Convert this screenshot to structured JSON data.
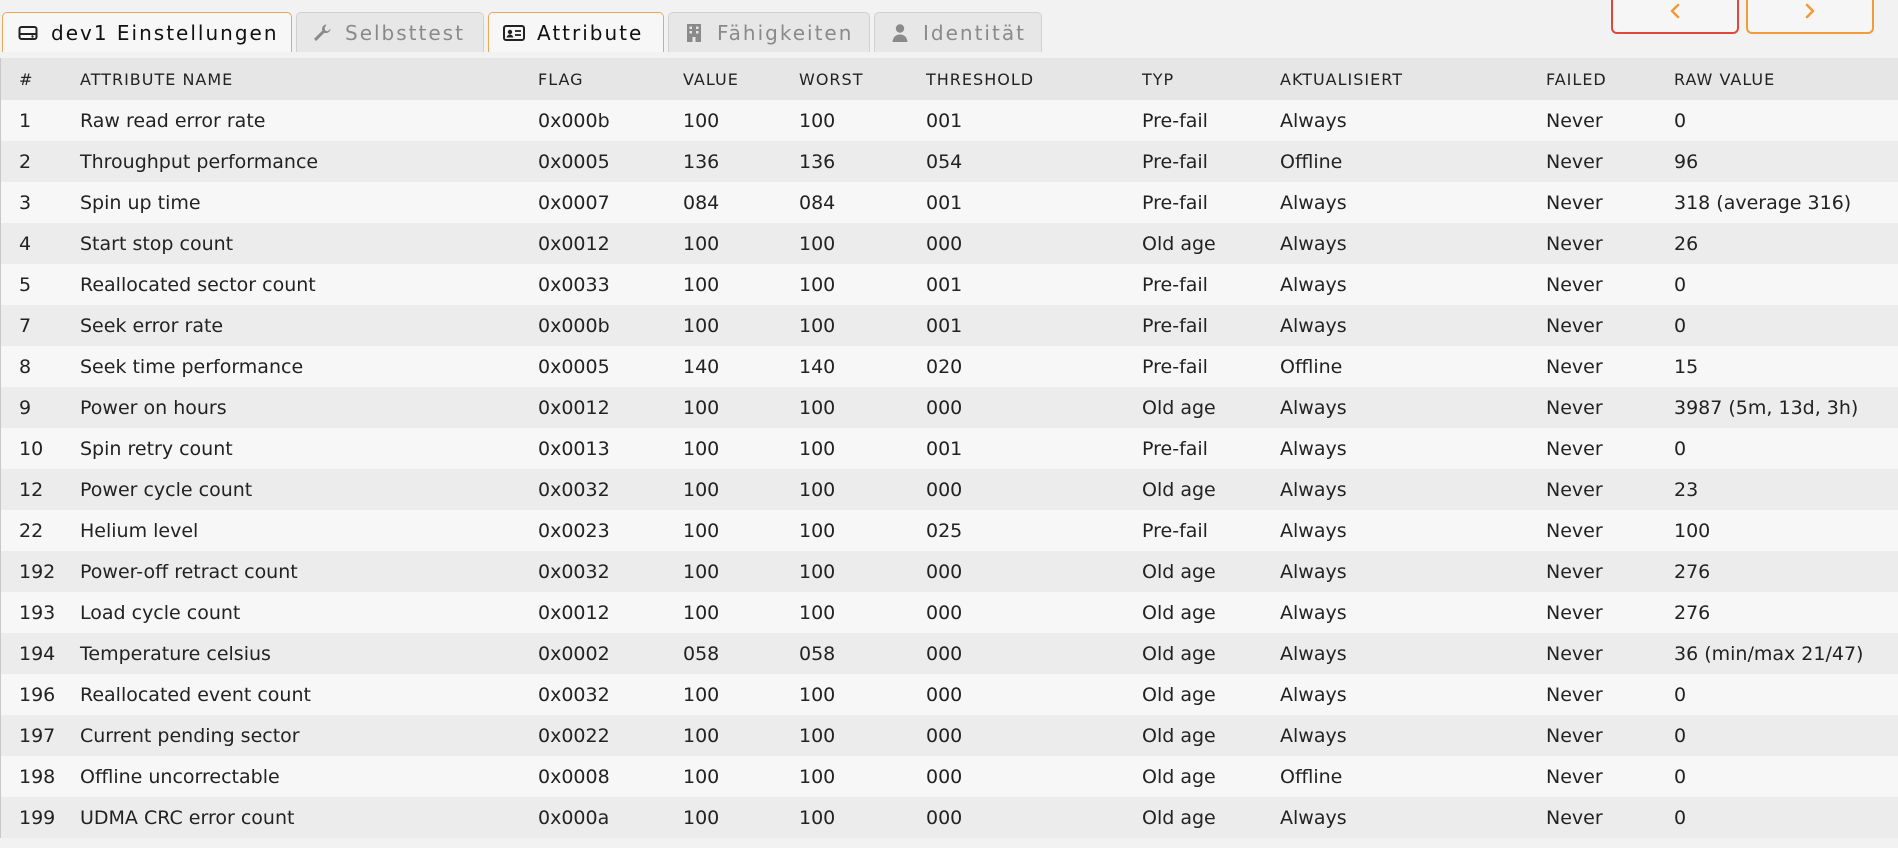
{
  "tabs": [
    {
      "label": "dev1 Einstellungen",
      "icon": "hard-drive-icon",
      "active": true
    },
    {
      "label": "Selbsttest",
      "icon": "wrench-icon",
      "active": false
    },
    {
      "label": "Attribute",
      "icon": "id-card-icon",
      "active": true
    },
    {
      "label": "Fähigkeiten",
      "icon": "building-icon",
      "active": false
    },
    {
      "label": "Identität",
      "icon": "user-icon",
      "active": false
    }
  ],
  "nav": {
    "prev_icon": "chevron-left-icon",
    "next_icon": "chevron-right-icon",
    "prev_color": "#e0483a",
    "next_color": "#f29b38"
  },
  "accent_color": "#f0a65a",
  "table": {
    "headers": [
      "#",
      "ATTRIBUTE NAME",
      "FLAG",
      "VALUE",
      "WORST",
      "THRESHOLD",
      "TYP",
      "AKTUALISIERT",
      "FAILED",
      "RAW VALUE"
    ],
    "rows": [
      [
        "1",
        "Raw read error rate",
        "0x000b",
        "100",
        "100",
        "001",
        "Pre-fail",
        "Always",
        "Never",
        "0"
      ],
      [
        "2",
        "Throughput performance",
        "0x0005",
        "136",
        "136",
        "054",
        "Pre-fail",
        "Offline",
        "Never",
        "96"
      ],
      [
        "3",
        "Spin up time",
        "0x0007",
        "084",
        "084",
        "001",
        "Pre-fail",
        "Always",
        "Never",
        "318 (average 316)"
      ],
      [
        "4",
        "Start stop count",
        "0x0012",
        "100",
        "100",
        "000",
        "Old age",
        "Always",
        "Never",
        "26"
      ],
      [
        "5",
        "Reallocated sector count",
        "0x0033",
        "100",
        "100",
        "001",
        "Pre-fail",
        "Always",
        "Never",
        "0"
      ],
      [
        "7",
        "Seek error rate",
        "0x000b",
        "100",
        "100",
        "001",
        "Pre-fail",
        "Always",
        "Never",
        "0"
      ],
      [
        "8",
        "Seek time performance",
        "0x0005",
        "140",
        "140",
        "020",
        "Pre-fail",
        "Offline",
        "Never",
        "15"
      ],
      [
        "9",
        "Power on hours",
        "0x0012",
        "100",
        "100",
        "000",
        "Old age",
        "Always",
        "Never",
        "3987 (5m, 13d, 3h)"
      ],
      [
        "10",
        "Spin retry count",
        "0x0013",
        "100",
        "100",
        "001",
        "Pre-fail",
        "Always",
        "Never",
        "0"
      ],
      [
        "12",
        "Power cycle count",
        "0x0032",
        "100",
        "100",
        "000",
        "Old age",
        "Always",
        "Never",
        "23"
      ],
      [
        "22",
        "Helium level",
        "0x0023",
        "100",
        "100",
        "025",
        "Pre-fail",
        "Always",
        "Never",
        "100"
      ],
      [
        "192",
        "Power-off retract count",
        "0x0032",
        "100",
        "100",
        "000",
        "Old age",
        "Always",
        "Never",
        "276"
      ],
      [
        "193",
        "Load cycle count",
        "0x0012",
        "100",
        "100",
        "000",
        "Old age",
        "Always",
        "Never",
        "276"
      ],
      [
        "194",
        "Temperature celsius",
        "0x0002",
        "058",
        "058",
        "000",
        "Old age",
        "Always",
        "Never",
        "36 (min/max 21/47)"
      ],
      [
        "196",
        "Reallocated event count",
        "0x0032",
        "100",
        "100",
        "000",
        "Old age",
        "Always",
        "Never",
        "0"
      ],
      [
        "197",
        "Current pending sector",
        "0x0022",
        "100",
        "100",
        "000",
        "Old age",
        "Always",
        "Never",
        "0"
      ],
      [
        "198",
        "Offline uncorrectable",
        "0x0008",
        "100",
        "100",
        "000",
        "Old age",
        "Offline",
        "Never",
        "0"
      ],
      [
        "199",
        "UDMA CRC error count",
        "0x000a",
        "100",
        "100",
        "000",
        "Old age",
        "Always",
        "Never",
        "0"
      ]
    ]
  }
}
